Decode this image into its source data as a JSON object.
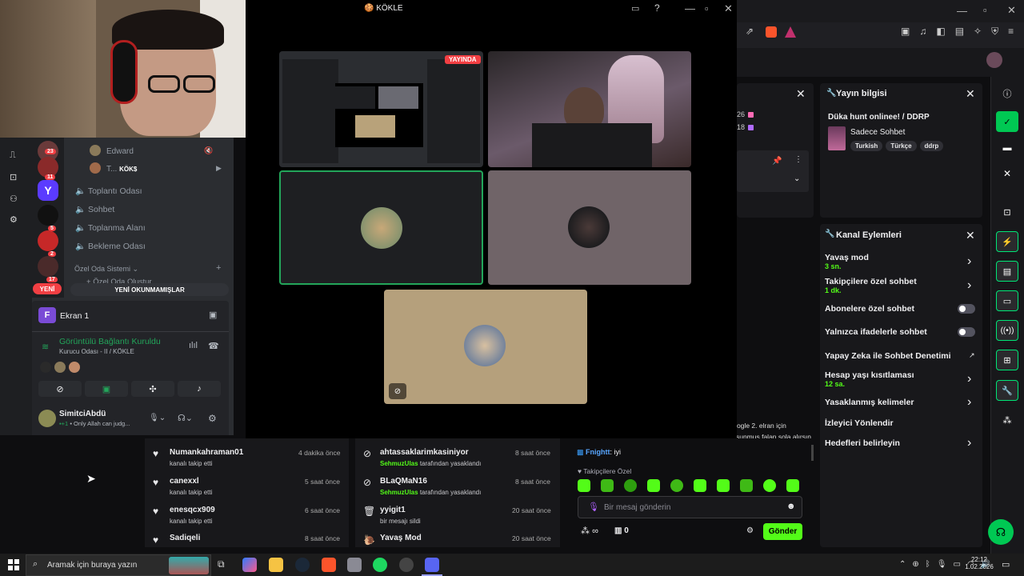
{
  "call_window": {
    "title": "KÖKLE",
    "live_badge": "YAYINDA"
  },
  "twitch": {
    "partial_texts": {
      "n1": "26",
      "n2": "18"
    },
    "stream_info": {
      "title": "Yayın bilgisi",
      "stream_title": "Düka hunt onlinee! / DDRP",
      "category": "Sadece Sohbet",
      "tags": [
        "Turkish",
        "Türkçe",
        "ddrp"
      ]
    },
    "channel_actions": {
      "title": "Kanal Eylemleri",
      "slow_mode": "Yavaş mod",
      "slow_mode_value": "3 sn.",
      "followers_only": "Takipçilere özel sohbet",
      "followers_only_value": "1 dk.",
      "subs_only": "Abonelere özel sohbet",
      "emotes_only": "Yalnızca ifadelerle sohbet",
      "ai_moderation": "Yapay Zeka ile Sohbet Denetimi",
      "account_age": "Hesap yaşı kısıtlaması",
      "account_age_value": "12 sa.",
      "banned_words": "Yasaklanmış kelimeler",
      "redirect": "İzleyici Yönlendir",
      "goals": "Hedefleri belirleyin"
    },
    "events_left": [
      {
        "name": "Numankahraman01",
        "sub": "kanalı takip etti",
        "time": "4 dakika önce"
      },
      {
        "name": "canexxl",
        "sub": "kanalı takip etti",
        "time": "5 saat önce"
      },
      {
        "name": "enesqcx909",
        "sub": "kanalı takip etti",
        "time": "6 saat önce"
      },
      {
        "name": "Sadiqeli",
        "sub": "",
        "time": "8 saat önce"
      }
    ],
    "events_right": [
      {
        "name": "ahtassaklarimkasiniyor",
        "mod": "SehmuzUlas",
        "sub": "tarafından yasaklandı",
        "time": "8 saat önce"
      },
      {
        "name": "BLaQMaN16",
        "mod": "SehmuzUlas",
        "sub": "tarafından yasaklandı",
        "time": "8 saat önce"
      },
      {
        "name": "yyigit1",
        "mod": "",
        "sub": "bir mesajı sildi",
        "time": "20 saat önce"
      },
      {
        "name": "Yavaş Mod",
        "mod": "",
        "sub": "",
        "time": "20 saat önce"
      }
    ],
    "chat": {
      "partial_line1": "ogle 2. elran için",
      "partial_line2": "şeyi şurası sunmuş falan sola alırsın",
      "msg_user": "Fnightt",
      "msg_text": ": iyi",
      "mode_label": "Takipçilere Özel",
      "input_placeholder": "Bir mesaj gönderin",
      "points": "∞",
      "count": "0",
      "send_label": "Gönder"
    }
  },
  "discord": {
    "server_badges": [
      "23",
      "11",
      "5",
      "2",
      "17"
    ],
    "users": [
      {
        "name": "Edward"
      },
      {
        "name": "T...",
        "tag": "KÖK$"
      }
    ],
    "channels": [
      "Toplantı Odası",
      "Sohbet",
      "Toplanma Alanı",
      "Bekleme Odası"
    ],
    "category": "Özel Oda Sistemi",
    "partial_channel": "Özel Oda Oluştur",
    "new_badge": "YENİ",
    "unread_button": "YENİ OKUNMAMIŞLAR",
    "screen_share": "Ekran 1",
    "voice_status": "Görüntülü Bağlantı Kuruldu",
    "voice_channel": "Kurucu Odası - II / KÖKLE",
    "user_name": "SimitciAbdü",
    "user_status": "• Only Allah can judg..."
  },
  "taskbar": {
    "search_placeholder": "Aramak için buraya yazın",
    "time": "22:12",
    "date": "1.02.2026"
  }
}
